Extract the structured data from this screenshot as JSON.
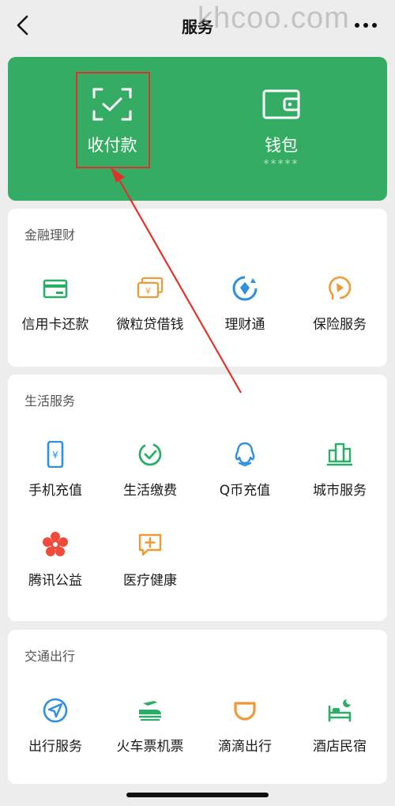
{
  "nav": {
    "title": "服务",
    "watermark": "khcoo.com"
  },
  "hero": {
    "pay": {
      "label": "收付款"
    },
    "wallet": {
      "label": "钱包",
      "masked": "*****"
    }
  },
  "sections": {
    "finance": {
      "title": "金融理财",
      "items": [
        "信用卡还款",
        "微粒贷借钱",
        "理财通",
        "保险服务"
      ]
    },
    "life": {
      "title": "生活服务",
      "items": [
        "手机充值",
        "生活缴费",
        "Q币充值",
        "城市服务",
        "腾讯公益",
        "医疗健康"
      ]
    },
    "travel": {
      "title": "交通出行",
      "items": [
        "出行服务",
        "火车票机票",
        "滴滴出行",
        "酒店民宿"
      ]
    }
  },
  "colors": {
    "accent_green": "#34ac63",
    "icon_green": "#2aae67",
    "icon_orange": "#f09a37",
    "icon_blue": "#2f8fe0",
    "icon_red": "#f04a3a",
    "annotation_red": "#e0322a"
  },
  "icons": {
    "finance": [
      "credit-card-icon",
      "loan-icon",
      "wealth-icon",
      "insurance-icon"
    ],
    "life": [
      "phone-topup-icon",
      "utilities-icon",
      "qq-coin-icon",
      "city-services-icon",
      "charity-icon",
      "medical-icon"
    ],
    "travel": [
      "mobility-icon",
      "train-ticket-icon",
      "didi-icon",
      "hotel-icon"
    ]
  }
}
